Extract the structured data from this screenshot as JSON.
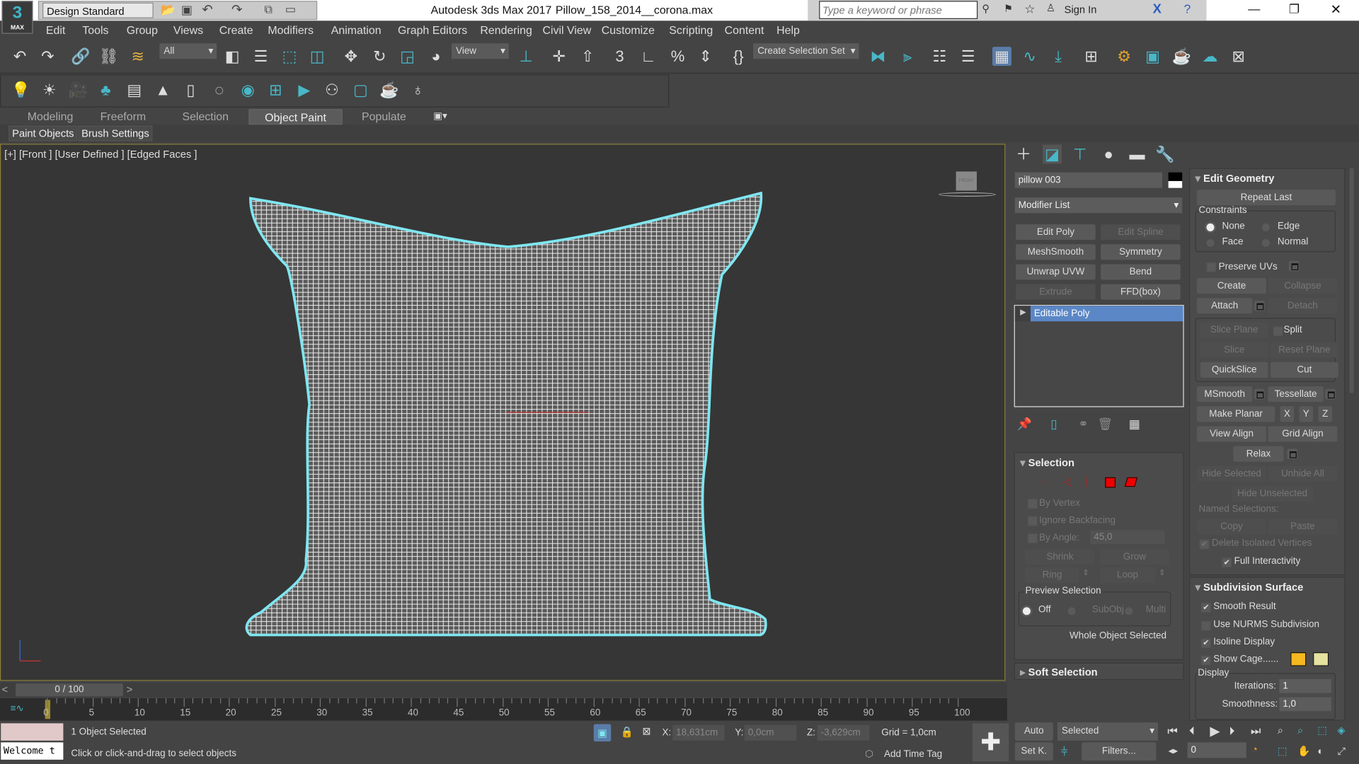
{
  "app": {
    "title": "Autodesk 3ds Max 2017",
    "file": "Pillow_158_2014__corona.max",
    "logo_num": "3",
    "logo_text": "MAX",
    "workspace": "Design Standard",
    "search_placeholder": "Type a keyword or phrase",
    "sign_in": "Sign In"
  },
  "menu": [
    "Edit",
    "Tools",
    "Group",
    "Views",
    "Create",
    "Modifiers",
    "Animation",
    "Graph Editors",
    "Rendering",
    "Civil View",
    "Customize",
    "Scripting",
    "Content",
    "Help"
  ],
  "toolbar": {
    "filter": "All",
    "ref_coord": "View",
    "selection_set": "Create Selection Set"
  },
  "ribbon": {
    "tabs": [
      "Modeling",
      "Freeform",
      "Selection",
      "Object Paint",
      "Populate"
    ],
    "active": "Object Paint",
    "subtabs": [
      "Paint Objects",
      "Brush Settings"
    ]
  },
  "viewport": {
    "label": "[+] [Front ] [User Defined ] [Edged Faces ]",
    "viewcube": "FRONT",
    "accent": "#7fe6f0"
  },
  "command_panel": {
    "object_name": "pillow 003",
    "modifier_list": "Modifier List",
    "modifier_buttons": [
      {
        "label": "Edit Poly",
        "enabled": true
      },
      {
        "label": "Edit Spline",
        "enabled": false
      },
      {
        "label": "MeshSmooth",
        "enabled": true
      },
      {
        "label": "Symmetry",
        "enabled": true
      },
      {
        "label": "Unwrap UVW",
        "enabled": true
      },
      {
        "label": "Bend",
        "enabled": true
      },
      {
        "label": "Extrude",
        "enabled": false
      },
      {
        "label": "FFD(box)",
        "enabled": true
      }
    ],
    "stack": [
      "Editable Poly"
    ],
    "selection": {
      "title": "Selection",
      "by_vertex": "By Vertex",
      "ignore_backfacing": "Ignore Backfacing",
      "by_angle": "By Angle:",
      "angle": "45,0",
      "shrink": "Shrink",
      "grow": "Grow",
      "ring": "Ring",
      "loop": "Loop",
      "preview": "Preview Selection",
      "off": "Off",
      "subobj": "SubObj",
      "multi": "Multi",
      "status": "Whole Object Selected"
    },
    "soft_selection": "Soft Selection",
    "edit_geometry": {
      "title": "Edit Geometry",
      "repeat_last": "Repeat Last",
      "constraints": "Constraints",
      "none": "None",
      "edge": "Edge",
      "face": "Face",
      "normal": "Normal",
      "preserve_uvs": "Preserve UVs",
      "create": "Create",
      "collapse": "Collapse",
      "attach": "Attach",
      "detach": "Detach",
      "slice_plane": "Slice Plane",
      "split": "Split",
      "slice": "Slice",
      "reset_plane": "Reset Plane",
      "quickslice": "QuickSlice",
      "cut": "Cut",
      "msmooth": "MSmooth",
      "tessellate": "Tessellate",
      "make_planar": "Make Planar",
      "x": "X",
      "y": "Y",
      "z": "Z",
      "view_align": "View Align",
      "grid_align": "Grid Align",
      "relax": "Relax",
      "hide_selected": "Hide Selected",
      "unhide_all": "Unhide All",
      "hide_unselected": "Hide Unselected",
      "named_selections": "Named Selections:",
      "copy": "Copy",
      "paste": "Paste",
      "delete_isolated": "Delete Isolated Vertices",
      "full_interactivity": "Full Interactivity"
    },
    "subdivision": {
      "title": "Subdivision Surface",
      "smooth_result": "Smooth Result",
      "use_nurms": "Use NURMS Subdivision",
      "isoline": "Isoline Display",
      "show_cage": "Show Cage......",
      "cage_color1": "#f5b820",
      "cage_color2": "#e6e2a0",
      "display": "Display",
      "iterations_label": "Iterations:",
      "iterations": "1",
      "smoothness_label": "Smoothness:",
      "smoothness": "1,0"
    }
  },
  "timeline": {
    "frame": "0 / 100",
    "ticks": [
      "0",
      "5",
      "10",
      "15",
      "20",
      "25",
      "30",
      "35",
      "40",
      "45",
      "50",
      "55",
      "60",
      "65",
      "70",
      "75",
      "80",
      "85",
      "90",
      "95",
      "100"
    ]
  },
  "status": {
    "selected": "1 Object Selected",
    "prompt": "Click or click-and-drag to select objects",
    "listener": "Welcome t",
    "x_label": "X:",
    "x": "18,631cm",
    "y_label": "Y:",
    "y": "0,0cm",
    "z_label": "Z:",
    "z": "-3,629cm",
    "grid": "Grid = 1,0cm",
    "add_time_tag": "Add Time Tag",
    "auto": "Auto",
    "set_key": "Set K.",
    "key_mode": "Selected",
    "filters": "Filters...",
    "current_frame": "0"
  }
}
